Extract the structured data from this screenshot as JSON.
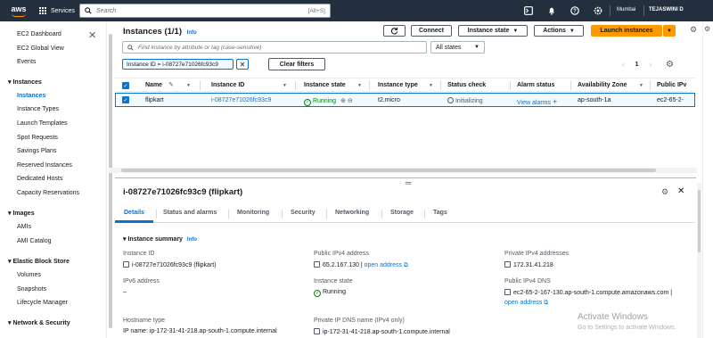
{
  "topnav": {
    "logo": "aws",
    "services": "Services",
    "search_placeholder": "Search",
    "search_shortcut": "[Alt+S]",
    "region": "Mumbai",
    "user": "TEJASWINI D",
    "icons": [
      "terminal-icon",
      "bell-icon",
      "help-icon",
      "gear-icon"
    ]
  },
  "sidebar": {
    "top": [
      "EC2 Dashboard",
      "EC2 Global View",
      "Events"
    ],
    "instances_header": "Instances",
    "instances": [
      "Instances",
      "Instance Types",
      "Launch Templates",
      "Spot Requests",
      "Savings Plans",
      "Reserved Instances",
      "Dedicated Hosts",
      "Capacity Reservations"
    ],
    "images_header": "Images",
    "images": [
      "AMIs",
      "AMI Catalog"
    ],
    "ebs_header": "Elastic Block Store",
    "ebs": [
      "Volumes",
      "Snapshots",
      "Lifecycle Manager"
    ],
    "network_header": "Network & Security"
  },
  "main": {
    "title": "Instances",
    "count": "(1/1)",
    "info": "Info",
    "buttons": {
      "connect": "Connect",
      "instance_state": "Instance state",
      "actions": "Actions",
      "launch": "Launch instances"
    },
    "filter_placeholder": "Find instance by attribute or tag (case-sensitive)",
    "states_select": "All states",
    "token": "Instance ID = i-08727e71026fc93c9",
    "clear_filters": "Clear filters",
    "page": "1",
    "columns": [
      "Name",
      "Instance ID",
      "Instance state",
      "Instance type",
      "Status check",
      "Alarm status",
      "Availability Zone",
      "Public IPv"
    ],
    "row": {
      "name": "flipkart",
      "instance_id": "i-08727e71026fc93c9",
      "state": "Running",
      "type": "t2.micro",
      "status_check": "Initializing",
      "alarm": "View alarms",
      "az": "ap-south-1a",
      "public_ip": "ec2-65-2-"
    }
  },
  "detail": {
    "title": "i-08727e71026fc93c9 (flipkart)",
    "tabs": [
      "Details",
      "Status and alarms",
      "Monitoring",
      "Security",
      "Networking",
      "Storage",
      "Tags"
    ],
    "section": "Instance summary",
    "section_info": "Info",
    "fields": {
      "instance_id_label": "Instance ID",
      "instance_id": "i-08727e71026fc93c9 (flipkart)",
      "public_ipv4_label": "Public IPv4 address",
      "public_ipv4": "65.2.167.130",
      "open_address": "open address",
      "private_ipv4_label": "Private IPv4 addresses",
      "private_ipv4": "172.31.41.218",
      "ipv6_label": "IPv6 address",
      "ipv6": "–",
      "instance_state_label": "Instance state",
      "instance_state": "Running",
      "public_dns_label": "Public IPv4 DNS",
      "public_dns": "ec2-65-2-167-130.ap-south-1.compute.amazonaws.com",
      "hostname_label": "Hostname type",
      "hostname": "IP name: ip-172-31-41-218.ap-south-1.compute.internal",
      "private_dns_label": "Private IP DNS name (IPv4 only)",
      "private_dns": "ip-172-31-41-218.ap-south-1.compute.internal"
    }
  },
  "watermark": {
    "title": "Activate Windows",
    "subtitle": "Go to Settings to activate Windows."
  },
  "colors": {
    "nav": "#232f3e",
    "accent": "#ff9900",
    "link": "#0972d3",
    "running": "#037f0c"
  }
}
